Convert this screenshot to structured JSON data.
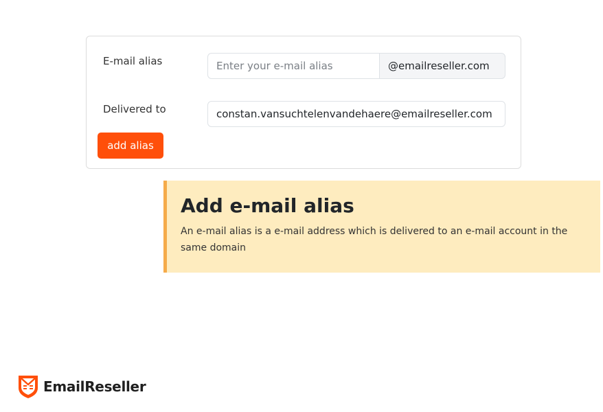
{
  "form": {
    "alias_label": "E-mail alias",
    "alias_placeholder": "Enter your e-mail alias",
    "alias_value": "",
    "domain_suffix": "@emailreseller.com",
    "delivered_label": "Delivered to",
    "delivered_value": "constan.vansuchtelenvandehaere@emailreseller.com",
    "submit_label": "add alias"
  },
  "info": {
    "title": "Add e-mail alias",
    "text": "An e-mail alias is a e-mail address which is delivered to an e-mail account in the same domain"
  },
  "brand": {
    "name": "EmailReseller",
    "logo_icon": "shield-envelope-icon",
    "accent_color": "#ff4f0a"
  },
  "colors": {
    "button": "#ff4f0a",
    "info_background": "#feecbf",
    "info_border": "#f5ab4a"
  }
}
